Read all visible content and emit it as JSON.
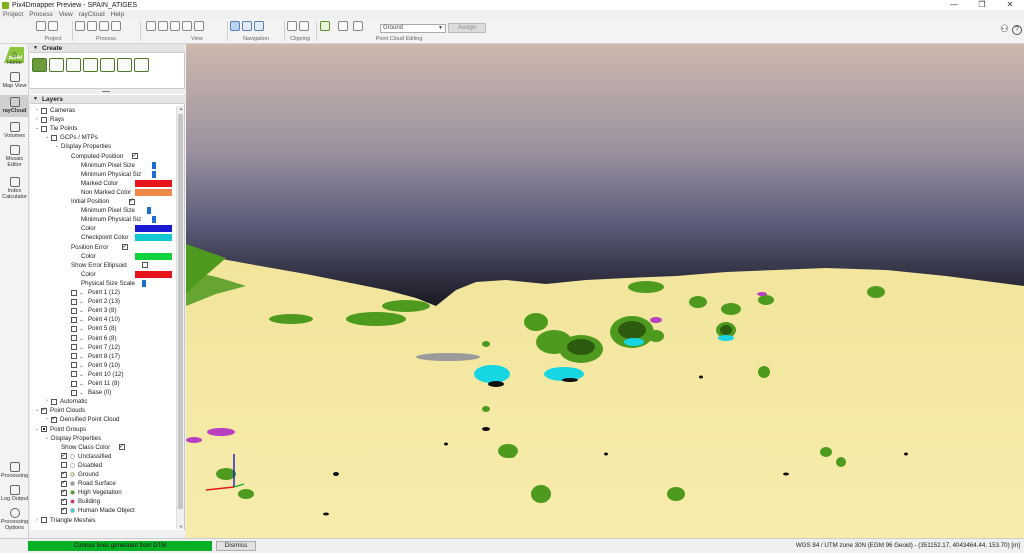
{
  "window": {
    "title": "Pix4Dmapper Preview - SPAIN_ATIGES",
    "controls": [
      "—",
      "❐",
      "✕"
    ]
  },
  "menu": [
    "Project",
    "Process",
    "View",
    "rayCloud",
    "Help"
  ],
  "toolbar": {
    "groups": [
      "Project",
      "Process",
      "View",
      "Navigation",
      "Clipping",
      "Point Cloud Editing"
    ],
    "class_select": "Ground",
    "assign_label": "Assign"
  },
  "nav": {
    "logo_text": "pix4d",
    "items": [
      "Home",
      "Map View",
      "rayCloud",
      "Volumes",
      "Mosaic Editor",
      "Index Calculator"
    ],
    "bottom": [
      "Processing",
      "Log Output",
      "Processing Options"
    ]
  },
  "panel": {
    "create_header": "Create",
    "layers_header": "Layers",
    "rows": [
      {
        "t": "Cameras",
        "lvl": 0,
        "arrow": "›",
        "cb": "off"
      },
      {
        "t": "Rays",
        "lvl": 0,
        "arrow": "›",
        "cb": "off"
      },
      {
        "t": "Tie Points",
        "lvl": 0,
        "arrow": "⌄",
        "cb": "off"
      },
      {
        "t": "GCPs / MTPs",
        "lvl": 1,
        "arrow": "⌄",
        "cb": "off"
      },
      {
        "t": "Display Properties",
        "lvl": 2,
        "arrow": "⌄"
      },
      {
        "t": "Computed Position",
        "lvl": 3,
        "check_after": "on"
      },
      {
        "t": "Minimum Pixel Size",
        "lvl": 4,
        "slider": 0.5
      },
      {
        "t": "Minimum Physical Siz",
        "lvl": 4,
        "slider": 0.5
      },
      {
        "t": "Marked Color",
        "lvl": 4,
        "color": "#e8141c"
      },
      {
        "t": "Non Marked Color",
        "lvl": 4,
        "color": "#f0884a"
      },
      {
        "t": "Initial Position",
        "lvl": 3,
        "check_after": "on"
      },
      {
        "t": "Minimum Pixel Size",
        "lvl": 4,
        "slider": 0.35
      },
      {
        "t": "Minimum Physical Siz",
        "lvl": 4,
        "slider": 0.5
      },
      {
        "t": "Color",
        "lvl": 4,
        "color": "#1a1ad2"
      },
      {
        "t": "Checkpoint Color",
        "lvl": 4,
        "color": "#0fc8d2"
      },
      {
        "t": "Position Error",
        "lvl": 3,
        "check_after": "on"
      },
      {
        "t": "Color",
        "lvl": 4,
        "color": "#10d23c"
      },
      {
        "t": "Show Error Ellipsoid",
        "lvl": 3,
        "check_after": "off"
      },
      {
        "t": "Color",
        "lvl": 4,
        "color": "#e8141c"
      },
      {
        "t": "Physical Size Scale",
        "lvl": 4,
        "slider": 0.2
      },
      {
        "t": "Point 1 (12)",
        "lvl": 3,
        "cb": "off",
        "pt": true
      },
      {
        "t": "Point 2 (13)",
        "lvl": 3,
        "cb": "off",
        "pt": true
      },
      {
        "t": "Point 3 (8)",
        "lvl": 3,
        "cb": "off",
        "pt": true
      },
      {
        "t": "Point 4 (10)",
        "lvl": 3,
        "cb": "off",
        "pt": true
      },
      {
        "t": "Point 5 (8)",
        "lvl": 3,
        "cb": "off",
        "pt": true
      },
      {
        "t": "Point 6 (8)",
        "lvl": 3,
        "cb": "off",
        "pt": true
      },
      {
        "t": "Point 7 (12)",
        "lvl": 3,
        "cb": "off",
        "pt": true
      },
      {
        "t": "Point 8 (17)",
        "lvl": 3,
        "cb": "off",
        "pt": true
      },
      {
        "t": "Point 9 (10)",
        "lvl": 3,
        "cb": "off",
        "pt": true
      },
      {
        "t": "Point 10 (12)",
        "lvl": 3,
        "cb": "off",
        "pt": true
      },
      {
        "t": "Point 11 (8)",
        "lvl": 3,
        "cb": "off",
        "pt": true
      },
      {
        "t": "Base (0)",
        "lvl": 3,
        "cb": "off",
        "pt": true
      },
      {
        "t": "Automatic",
        "lvl": 1,
        "arrow": "›",
        "cb": "off"
      },
      {
        "t": "Point Clouds",
        "lvl": 0,
        "arrow": "⌄",
        "cb": "on"
      },
      {
        "t": "Densified Point Cloud",
        "lvl": 1,
        "arrow": "›",
        "cb": "on"
      },
      {
        "t": "Point Groups",
        "lvl": 0,
        "arrow": "⌄",
        "cb": "mixed"
      },
      {
        "t": "Display Properties",
        "lvl": 1,
        "arrow": "⌄"
      },
      {
        "t": "Show Class Color",
        "lvl": 2,
        "check_after": "on"
      },
      {
        "t": "Unclassified",
        "lvl": 2,
        "cb": "on",
        "dot": "#ffffff"
      },
      {
        "t": "Disabled",
        "lvl": 2,
        "cb": "off",
        "dot": "#ffffff"
      },
      {
        "t": "Ground",
        "lvl": 2,
        "cb": "on",
        "dot": "#e8df8a"
      },
      {
        "t": "Road Surface",
        "lvl": 2,
        "cb": "on",
        "dot": "#9a9a9a"
      },
      {
        "t": "High Vegetation",
        "lvl": 2,
        "cb": "on",
        "dot": "#3d9d10"
      },
      {
        "t": "Building",
        "lvl": 2,
        "cb": "on",
        "dot": "#e0148c"
      },
      {
        "t": "Human Made Object",
        "lvl": 2,
        "cb": "on",
        "dot": "#18d8e8"
      },
      {
        "t": "Triangle Meshes",
        "lvl": 0,
        "arrow": "›",
        "cb": "off"
      }
    ]
  },
  "status": {
    "message": "Contour lines generated from DTM",
    "dismiss_label": "Dismiss",
    "coordinates": "WGS 84 / UTM zone 30N (EGM 96 Geoid) - (351152.17, 4043464.44, 153.70) [m]"
  },
  "colors": {
    "accent": "#06b025",
    "ground": "#f6ea9c",
    "vegetation": "#4d9a1d",
    "sky_top": "#c8b8b0",
    "sky_bottom": "#0a0a0e"
  }
}
